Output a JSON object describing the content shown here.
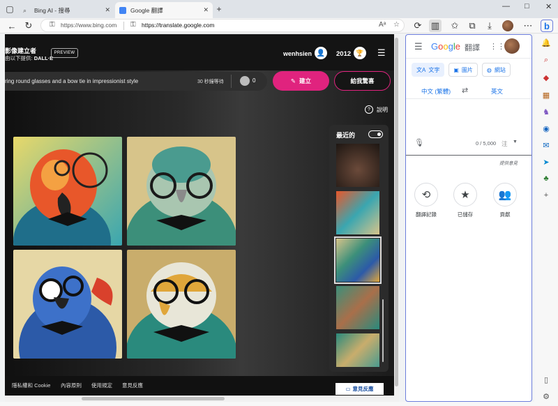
{
  "browser": {
    "tabs": [
      {
        "title": "Bing AI - 搜尋",
        "active": false
      },
      {
        "title": "Google 翻譯",
        "active": true
      }
    ],
    "address": {
      "left_url": "https://www.bing.com",
      "right_url": "https://translate.google.com"
    },
    "window_controls": [
      "—",
      "□",
      "✕"
    ]
  },
  "bing": {
    "title": "影像建立者",
    "subtitle_prefix": "由以下提供:",
    "subtitle_brand": "DALL·E",
    "preview_badge": "PREVIEW",
    "username": "wenhsien",
    "boost_count": "2012",
    "prompt_text": "ring round glasses and a bow tie in impressionist style",
    "wait_text": "30 秒鐘等待",
    "boost_remaining": "0",
    "create_label": "建立",
    "surprise_label": "給我驚喜",
    "help_label": "說明",
    "recent_label": "最近的",
    "footer_links": [
      "隱私權和 Cookie",
      "內容原則",
      "使用規定",
      "意見反應"
    ],
    "feedback_button": "意見反應"
  },
  "translate": {
    "brand": "Google",
    "product": "翻譯",
    "modes": [
      {
        "label": "文字",
        "icon": "translate-icon",
        "active": true
      },
      {
        "label": "圖片",
        "icon": "image-icon",
        "active": false
      },
      {
        "label": "網站",
        "icon": "globe-icon",
        "active": false
      }
    ],
    "source_lang": "中文 (繁體)",
    "target_lang": "英文",
    "char_count": "0 / 5,000",
    "ime_label": "注",
    "feedback_link": "提供意見",
    "actions": [
      {
        "label": "翻譯記錄",
        "icon": "history-icon"
      },
      {
        "label": "已儲存",
        "icon": "star-icon"
      },
      {
        "label": "貢獻",
        "icon": "people-icon"
      }
    ]
  },
  "colors": {
    "accent_pink": "#e0237e",
    "google_blue": "#1a73e8",
    "sidebar_border": "#6c7ddc"
  }
}
